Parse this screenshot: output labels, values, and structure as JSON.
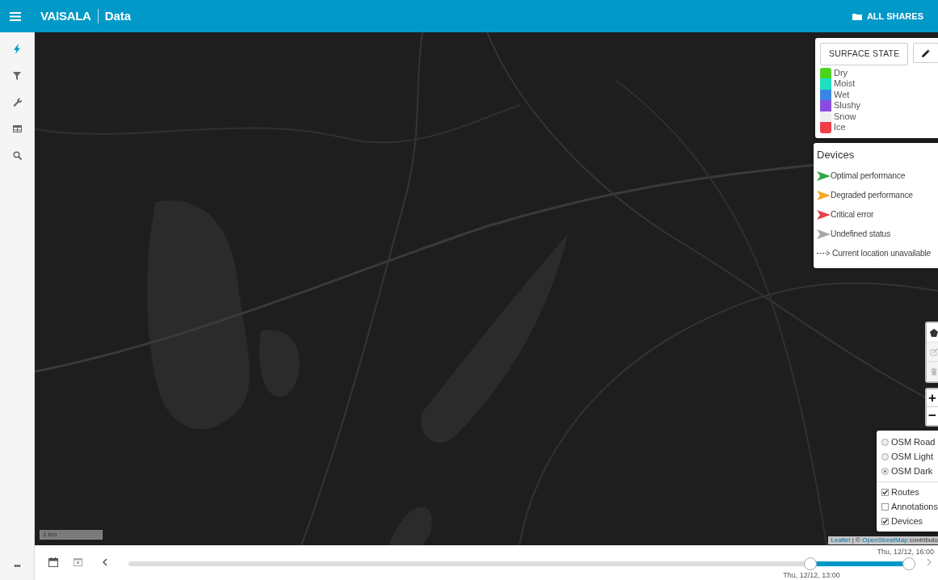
{
  "header": {
    "brand": "VAISALA",
    "section": "Data",
    "shares_button": "ALL SHARES"
  },
  "sidebar": {
    "items": [
      {
        "selected": true
      },
      {
        "selected": false
      },
      {
        "selected": false
      },
      {
        "selected": false
      },
      {
        "selected": false
      }
    ],
    "more": "•••"
  },
  "surface_legend": {
    "button": "SURFACE STATE",
    "items": [
      {
        "label": "Dry",
        "color": "#4cd31e"
      },
      {
        "label": "Moist",
        "color": "#1ee0c0"
      },
      {
        "label": "Wet",
        "color": "#3a86e6"
      },
      {
        "label": "Slushy",
        "color": "#8a4ce0"
      },
      {
        "label": "Snow",
        "color": "#eeeeee"
      },
      {
        "label": "Ice",
        "color": "#ee3e48"
      }
    ]
  },
  "devices_legend": {
    "title": "Devices",
    "items": [
      {
        "kind": "arrow",
        "label": "Optimal performance",
        "color": "#2ea84a"
      },
      {
        "kind": "arrow",
        "label": "Degraded performance",
        "color": "#f5a623"
      },
      {
        "kind": "arrow",
        "label": "Critical error",
        "color": "#e8404a"
      },
      {
        "kind": "arrow",
        "label": "Undefined status",
        "color": "#a6a6a6"
      },
      {
        "kind": "dashed",
        "label": "Current location unavailable"
      }
    ]
  },
  "draw_toolbar": [
    {
      "disabled": false
    },
    {
      "disabled": true
    },
    {
      "disabled": true
    }
  ],
  "zoom": {
    "in": "+",
    "out": "−"
  },
  "layers": {
    "base": [
      {
        "label": "OSM Road",
        "selected": false
      },
      {
        "label": "OSM Light",
        "selected": false
      },
      {
        "label": "OSM Dark",
        "selected": true
      }
    ],
    "overlays": [
      {
        "label": "Routes",
        "checked": true
      },
      {
        "label": "Annotations",
        "checked": false
      },
      {
        "label": "Devices",
        "checked": true
      }
    ]
  },
  "scale": "1 km",
  "attribution": {
    "link1": "Leaflet",
    "separator": " | © ",
    "link2": "OpenStreetMap",
    "rest": " contributo"
  },
  "timeline": {
    "start": {
      "level": 0.874,
      "label": "Thu, 12/12, 13:00"
    },
    "end": {
      "level": 1.0,
      "label": "Thu, 12/12, 16:00"
    },
    "next_disabled": true
  }
}
